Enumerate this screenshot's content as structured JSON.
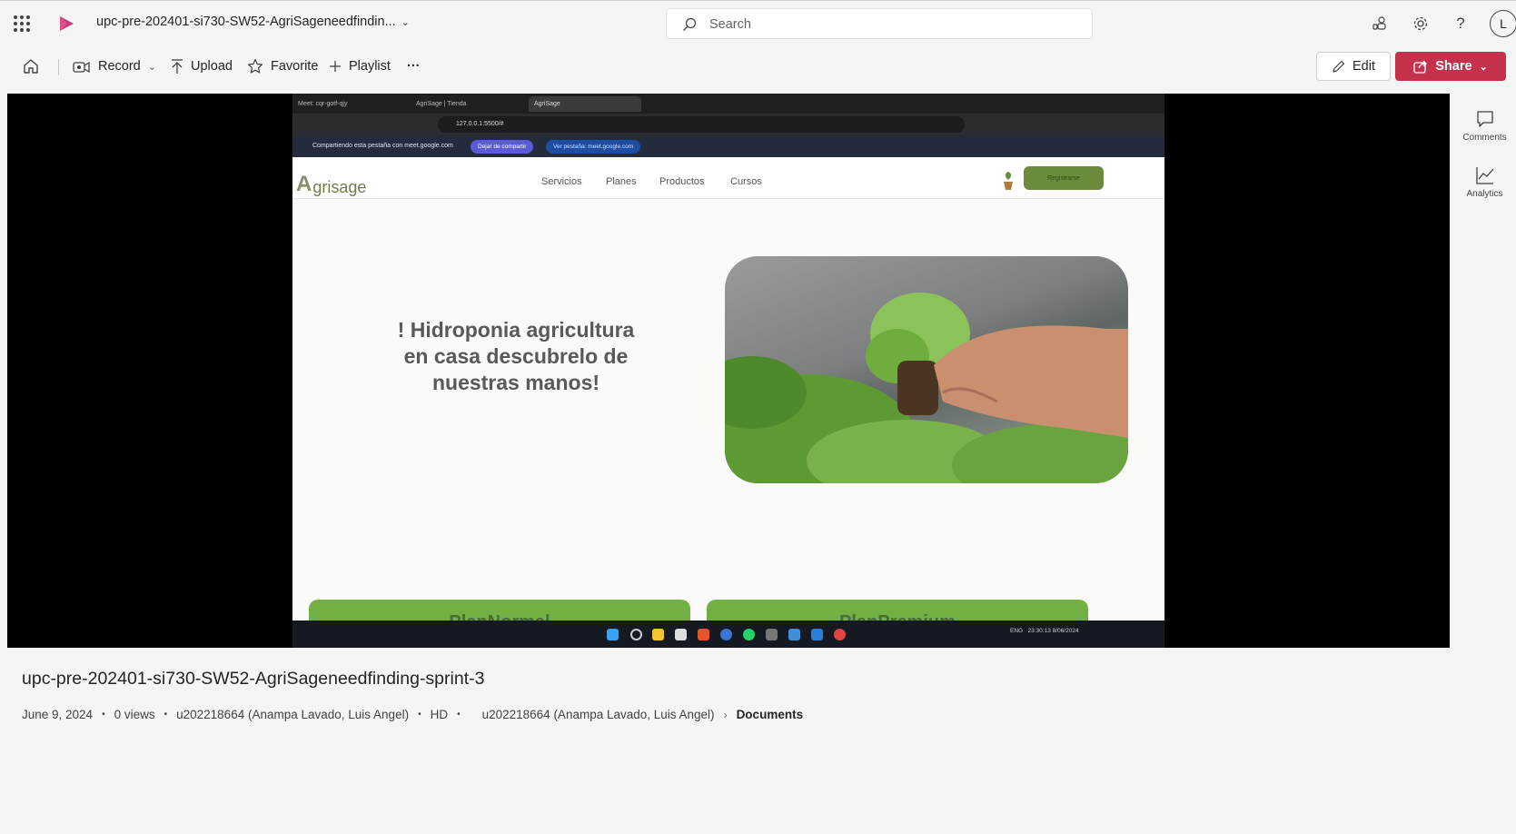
{
  "header": {
    "title": "upc-pre-202401-si730-SW52-AgriSageneedfindin...",
    "search_placeholder": "Search",
    "avatar_initial": "L"
  },
  "commands": {
    "record": "Record",
    "upload": "Upload",
    "favorite": "Favorite",
    "playlist": "Playlist",
    "more": "···",
    "edit": "Edit",
    "share": "Share"
  },
  "video": {
    "browser_tabs": [
      "Meet: cqr-gotf-qjy",
      "AgriSage | Tienda",
      "AgriSage"
    ],
    "url": "127.0.0.1:5500/#",
    "share_text": "Compartiendo esta pestaña con meet.google.com",
    "stop_share": "Dejar de compartir",
    "view_tab": "Ver pestaña: meet.google.com",
    "site_brand": "grisage",
    "site_brand_initial": "A",
    "nav": [
      "Servicios",
      "Planes",
      "Productos",
      "Cursos"
    ],
    "register_button": "Registrarse",
    "hero_text": "! Hidroponia agricultura en casa descubrelo de nuestras manos!",
    "plan_cards": [
      "PlanNormal",
      "PlanPremium"
    ],
    "clock_time": "23:30:13",
    "clock_date": "8/06/2024",
    "tray_lang": "ENG"
  },
  "rail": {
    "comments": "Comments",
    "analytics": "Analytics"
  },
  "details": {
    "title": "upc-pre-202401-si730-SW52-AgriSageneedfinding-sprint-3",
    "date": "June 9, 2024",
    "views": "0 views",
    "owner": "u202218664 (Anampa Lavado, Luis Angel)",
    "quality": "HD",
    "breadcrumb_owner": "u202218664 (Anampa Lavado, Luis Angel)",
    "breadcrumb_folder": "Documents"
  },
  "colors": {
    "share_button": "#c4314b",
    "app_logo": "#c43e7a",
    "plan_card": "#72b043"
  }
}
